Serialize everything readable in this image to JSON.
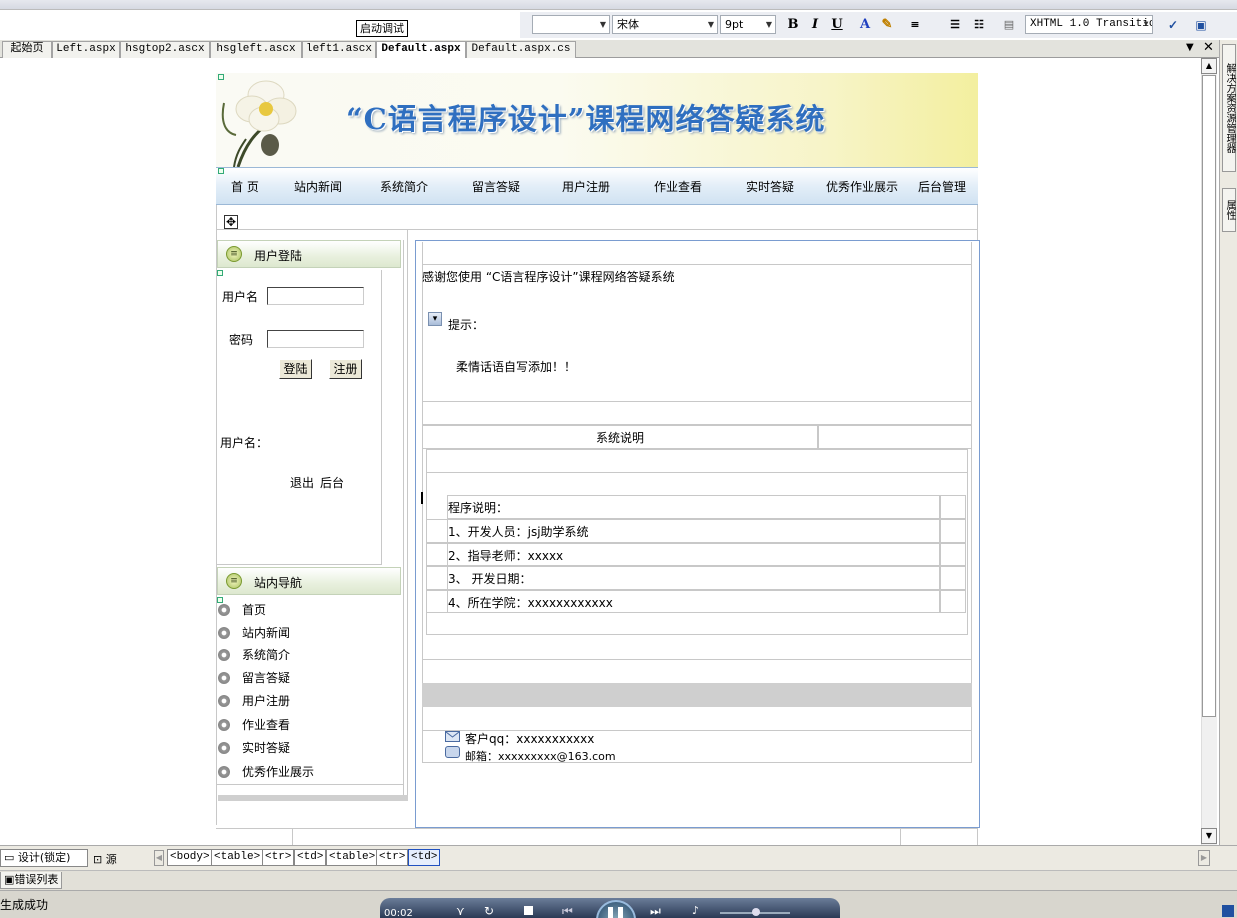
{
  "ide": {
    "tooltip": "启动调试",
    "format_bar": {
      "block_format": "",
      "font": "宋体",
      "size": "9pt",
      "bold": "B",
      "italic": "I",
      "underline": "U",
      "doctype": "XHTML 1.0 Transitio"
    },
    "tabs": [
      {
        "label": "起始页"
      },
      {
        "label": "Left.aspx"
      },
      {
        "label": "hsgtop2.ascx"
      },
      {
        "label": "hsgleft.ascx"
      },
      {
        "label": "left1.ascx"
      },
      {
        "label": "Default.aspx",
        "active": true
      },
      {
        "label": "Default.aspx.cs"
      }
    ],
    "side_dock": [
      "解决方案资源管理器",
      "属性"
    ],
    "view_tabs": {
      "design": "设计(锁定)",
      "source": "源"
    },
    "tag_path": [
      "<body>",
      "<table>",
      "<tr>",
      "<td>",
      "<table>",
      "<tr>",
      "<td>"
    ],
    "error_list": "错误列表",
    "status": "生成成功",
    "media_time": "00:02"
  },
  "page": {
    "banner_title": "“C语言程序设计”课程网络答疑系统",
    "nav": [
      "首 页",
      "站内新闻",
      "系统简介",
      "留言答疑",
      "用户注册",
      "作业查看",
      "实时答疑",
      "优秀作业展示",
      "后台管理"
    ],
    "login": {
      "title": "用户登陆",
      "username_label": "用户名",
      "password_label": "密码",
      "login_button": "登陆",
      "register_button": "注册",
      "user_label": "用户名：",
      "logout": "退出",
      "admin": "后台"
    },
    "site_nav": {
      "title": "站内导航",
      "items": [
        "首页",
        "站内新闻",
        "系统简介",
        "留言答疑",
        "用户注册",
        "作业查看",
        "实时答疑",
        "优秀作业展示"
      ]
    },
    "main": {
      "welcome": "感谢您使用 “C语言程序设计”课程网络答疑系统",
      "tip_label": "提示：",
      "tip_text": "柔情话语自写添加！！",
      "section_title": "系统说明",
      "program_rows": [
        "程序说明：",
        "1、开发人员：jsj助学系统",
        "2、指导老师：xxxxx",
        "3、 开发日期：",
        "4、所在学院：xxxxxxxxxxxx"
      ],
      "contact_qq": "客户qq：xxxxxxxxxxx",
      "contact_mail": "邮箱：xxxxxxxxx@163.com"
    }
  }
}
